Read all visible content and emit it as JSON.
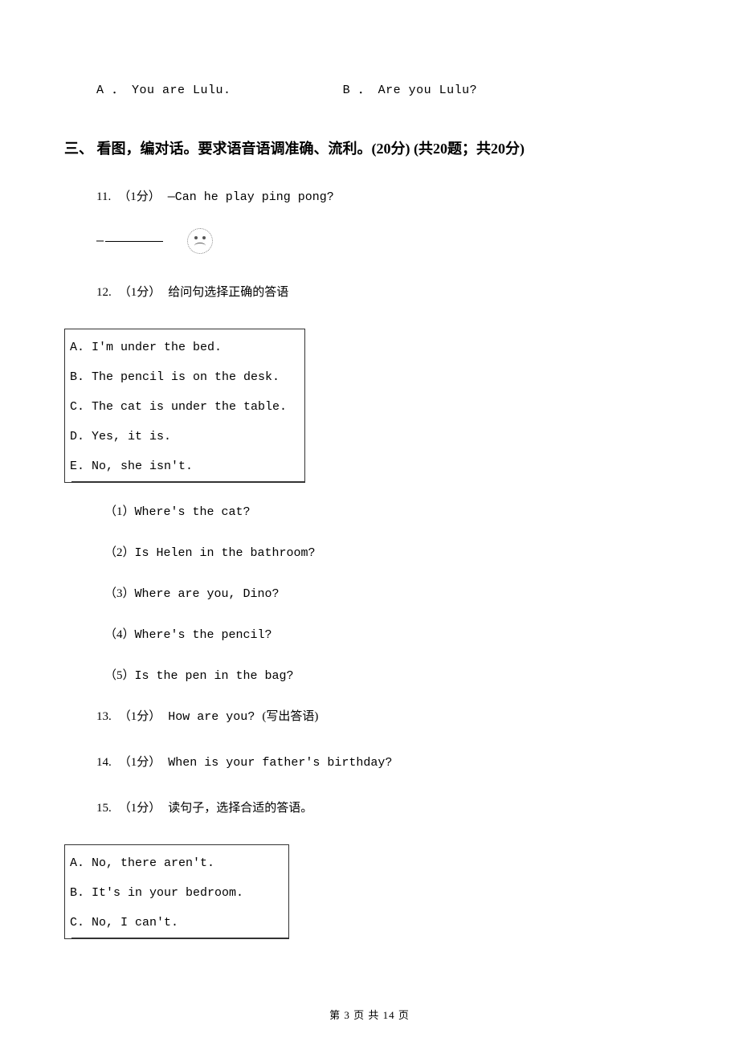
{
  "top_options": {
    "a_label": "A ．",
    "a_text": "You are Lulu.",
    "b_label": "B ．",
    "b_text": "Are you Lulu?"
  },
  "section": {
    "number": "三、",
    "title": " 看图，编对话。要求语音语调准确、流利。(20分) (共20题；共20分)"
  },
  "q11": {
    "number": "11.",
    "score": "（1分）",
    "prompt": "—Can he play ping pong?",
    "answer_dash": "—"
  },
  "q12": {
    "number": "12.",
    "score": "（1分）",
    "prompt": "给问句选择正确的答语",
    "box": {
      "a": "A. I'm under the bed.",
      "b": "B. The pencil is on the desk.",
      "c": "C. The cat is under the table.",
      "d": "D. Yes, it is.",
      "e": "E. No, she isn't."
    },
    "subs": {
      "s1_num": "（1）",
      "s1": "Where's the cat?",
      "s2_num": "（2）",
      "s2": "Is Helen in the bathroom?",
      "s3_num": "（3）",
      "s3": "Where are you, Dino?",
      "s4_num": "（4）",
      "s4": "Where's the pencil?",
      "s5_num": "（5）",
      "s5": "Is the pen in the bag?"
    }
  },
  "q13": {
    "number": "13.",
    "score": "（1分）",
    "prompt_en": "How are you? ",
    "prompt_cn": "(写出答语)"
  },
  "q14": {
    "number": "14.",
    "score": "（1分）",
    "prompt": "When is your father's birthday?"
  },
  "q15": {
    "number": "15.",
    "score": "（1分）",
    "prompt": "读句子，选择合适的答语。",
    "box": {
      "a": "A. No, there aren't.",
      "b": "B. It's in your bedroom.",
      "c": "C. No, I can't."
    }
  },
  "footer": {
    "text": "第 3 页 共 14 页"
  }
}
